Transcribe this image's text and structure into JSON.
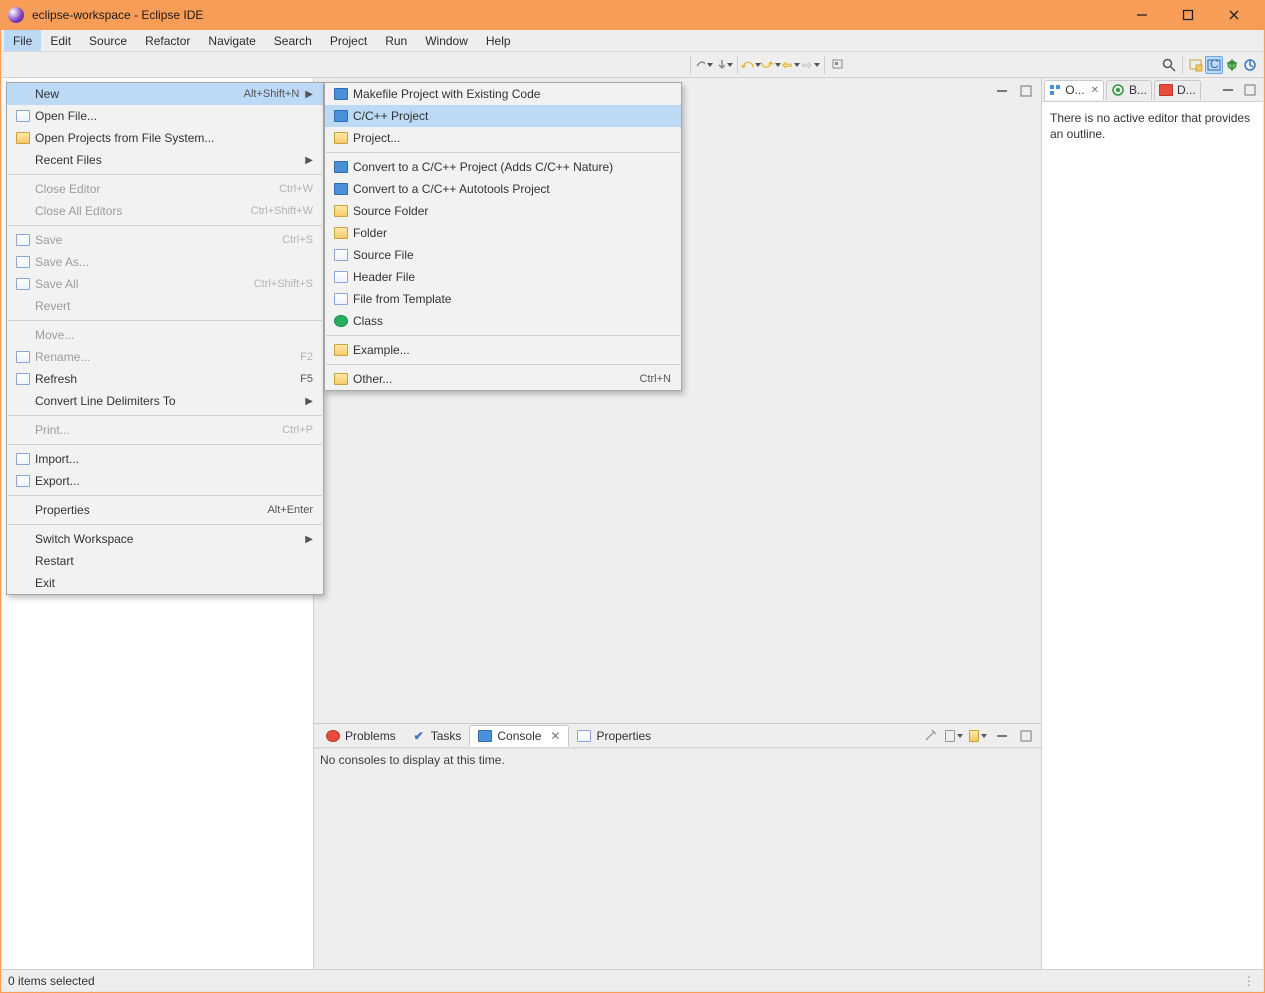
{
  "window": {
    "title": "eclipse-workspace - Eclipse IDE"
  },
  "menubar": [
    "File",
    "Edit",
    "Source",
    "Refactor",
    "Navigate",
    "Search",
    "Project",
    "Run",
    "Window",
    "Help"
  ],
  "fileMenu": {
    "items": [
      {
        "label": "New",
        "accel": "Alt+Shift+N",
        "sub": true,
        "highlight": true
      },
      {
        "label": "Open File...",
        "icon": "doc"
      },
      {
        "label": "Open Projects from File System...",
        "icon": "folder"
      },
      {
        "label": "Recent Files",
        "sub": true
      },
      {
        "sep": true
      },
      {
        "label": "Close Editor",
        "accel": "Ctrl+W",
        "disabled": true
      },
      {
        "label": "Close All Editors",
        "accel": "Ctrl+Shift+W",
        "disabled": true
      },
      {
        "sep": true
      },
      {
        "label": "Save",
        "accel": "Ctrl+S",
        "disabled": true,
        "icon": "doc"
      },
      {
        "label": "Save As...",
        "disabled": true,
        "icon": "doc"
      },
      {
        "label": "Save All",
        "accel": "Ctrl+Shift+S",
        "disabled": true,
        "icon": "doc"
      },
      {
        "label": "Revert",
        "disabled": true
      },
      {
        "sep": true
      },
      {
        "label": "Move...",
        "disabled": true
      },
      {
        "label": "Rename...",
        "accel": "F2",
        "disabled": true,
        "icon": "doc"
      },
      {
        "label": "Refresh",
        "accel": "F5",
        "icon": "doc"
      },
      {
        "label": "Convert Line Delimiters To",
        "sub": true
      },
      {
        "sep": true
      },
      {
        "label": "Print...",
        "accel": "Ctrl+P",
        "disabled": true
      },
      {
        "sep": true
      },
      {
        "label": "Import...",
        "icon": "doc"
      },
      {
        "label": "Export...",
        "icon": "doc"
      },
      {
        "sep": true
      },
      {
        "label": "Properties",
        "accel": "Alt+Enter"
      },
      {
        "sep": true
      },
      {
        "label": "Switch Workspace",
        "sub": true
      },
      {
        "label": "Restart"
      },
      {
        "label": "Exit"
      }
    ]
  },
  "newMenu": {
    "items": [
      {
        "label": "Makefile Project with Existing Code",
        "icon": "blue"
      },
      {
        "label": "C/C++ Project",
        "icon": "blue",
        "highlight": true
      },
      {
        "label": "Project...",
        "icon": "folder"
      },
      {
        "sep": true
      },
      {
        "label": "Convert to a C/C++ Project (Adds C/C++ Nature)",
        "icon": "blue"
      },
      {
        "label": "Convert to a C/C++ Autotools Project",
        "icon": "blue"
      },
      {
        "label": "Source Folder",
        "icon": "folder"
      },
      {
        "label": "Folder",
        "icon": "folder"
      },
      {
        "label": "Source File",
        "icon": "doc"
      },
      {
        "label": "Header File",
        "icon": "doc"
      },
      {
        "label": "File from Template",
        "icon": "doc"
      },
      {
        "label": "Class",
        "icon": "green"
      },
      {
        "sep": true
      },
      {
        "label": "Example...",
        "icon": "folder"
      },
      {
        "sep": true
      },
      {
        "label": "Other...",
        "accel": "Ctrl+N",
        "icon": "folder"
      }
    ]
  },
  "rightTabs": {
    "tabs": [
      {
        "short": "O...",
        "kind": "outline",
        "active": true
      },
      {
        "short": "B...",
        "kind": "build"
      },
      {
        "short": "D...",
        "kind": "doc"
      }
    ]
  },
  "outlineText": "There is no active editor that provides an outline.",
  "bottomTabs": {
    "tabs": [
      {
        "label": "Problems",
        "icon": "red"
      },
      {
        "label": "Tasks",
        "icon": "doc"
      },
      {
        "label": "Console",
        "icon": "blue",
        "active": true
      },
      {
        "label": "Properties",
        "icon": "doc"
      }
    ]
  },
  "consoleText": "No consoles to display at this time.",
  "statusbar": {
    "text": "0 items selected"
  }
}
